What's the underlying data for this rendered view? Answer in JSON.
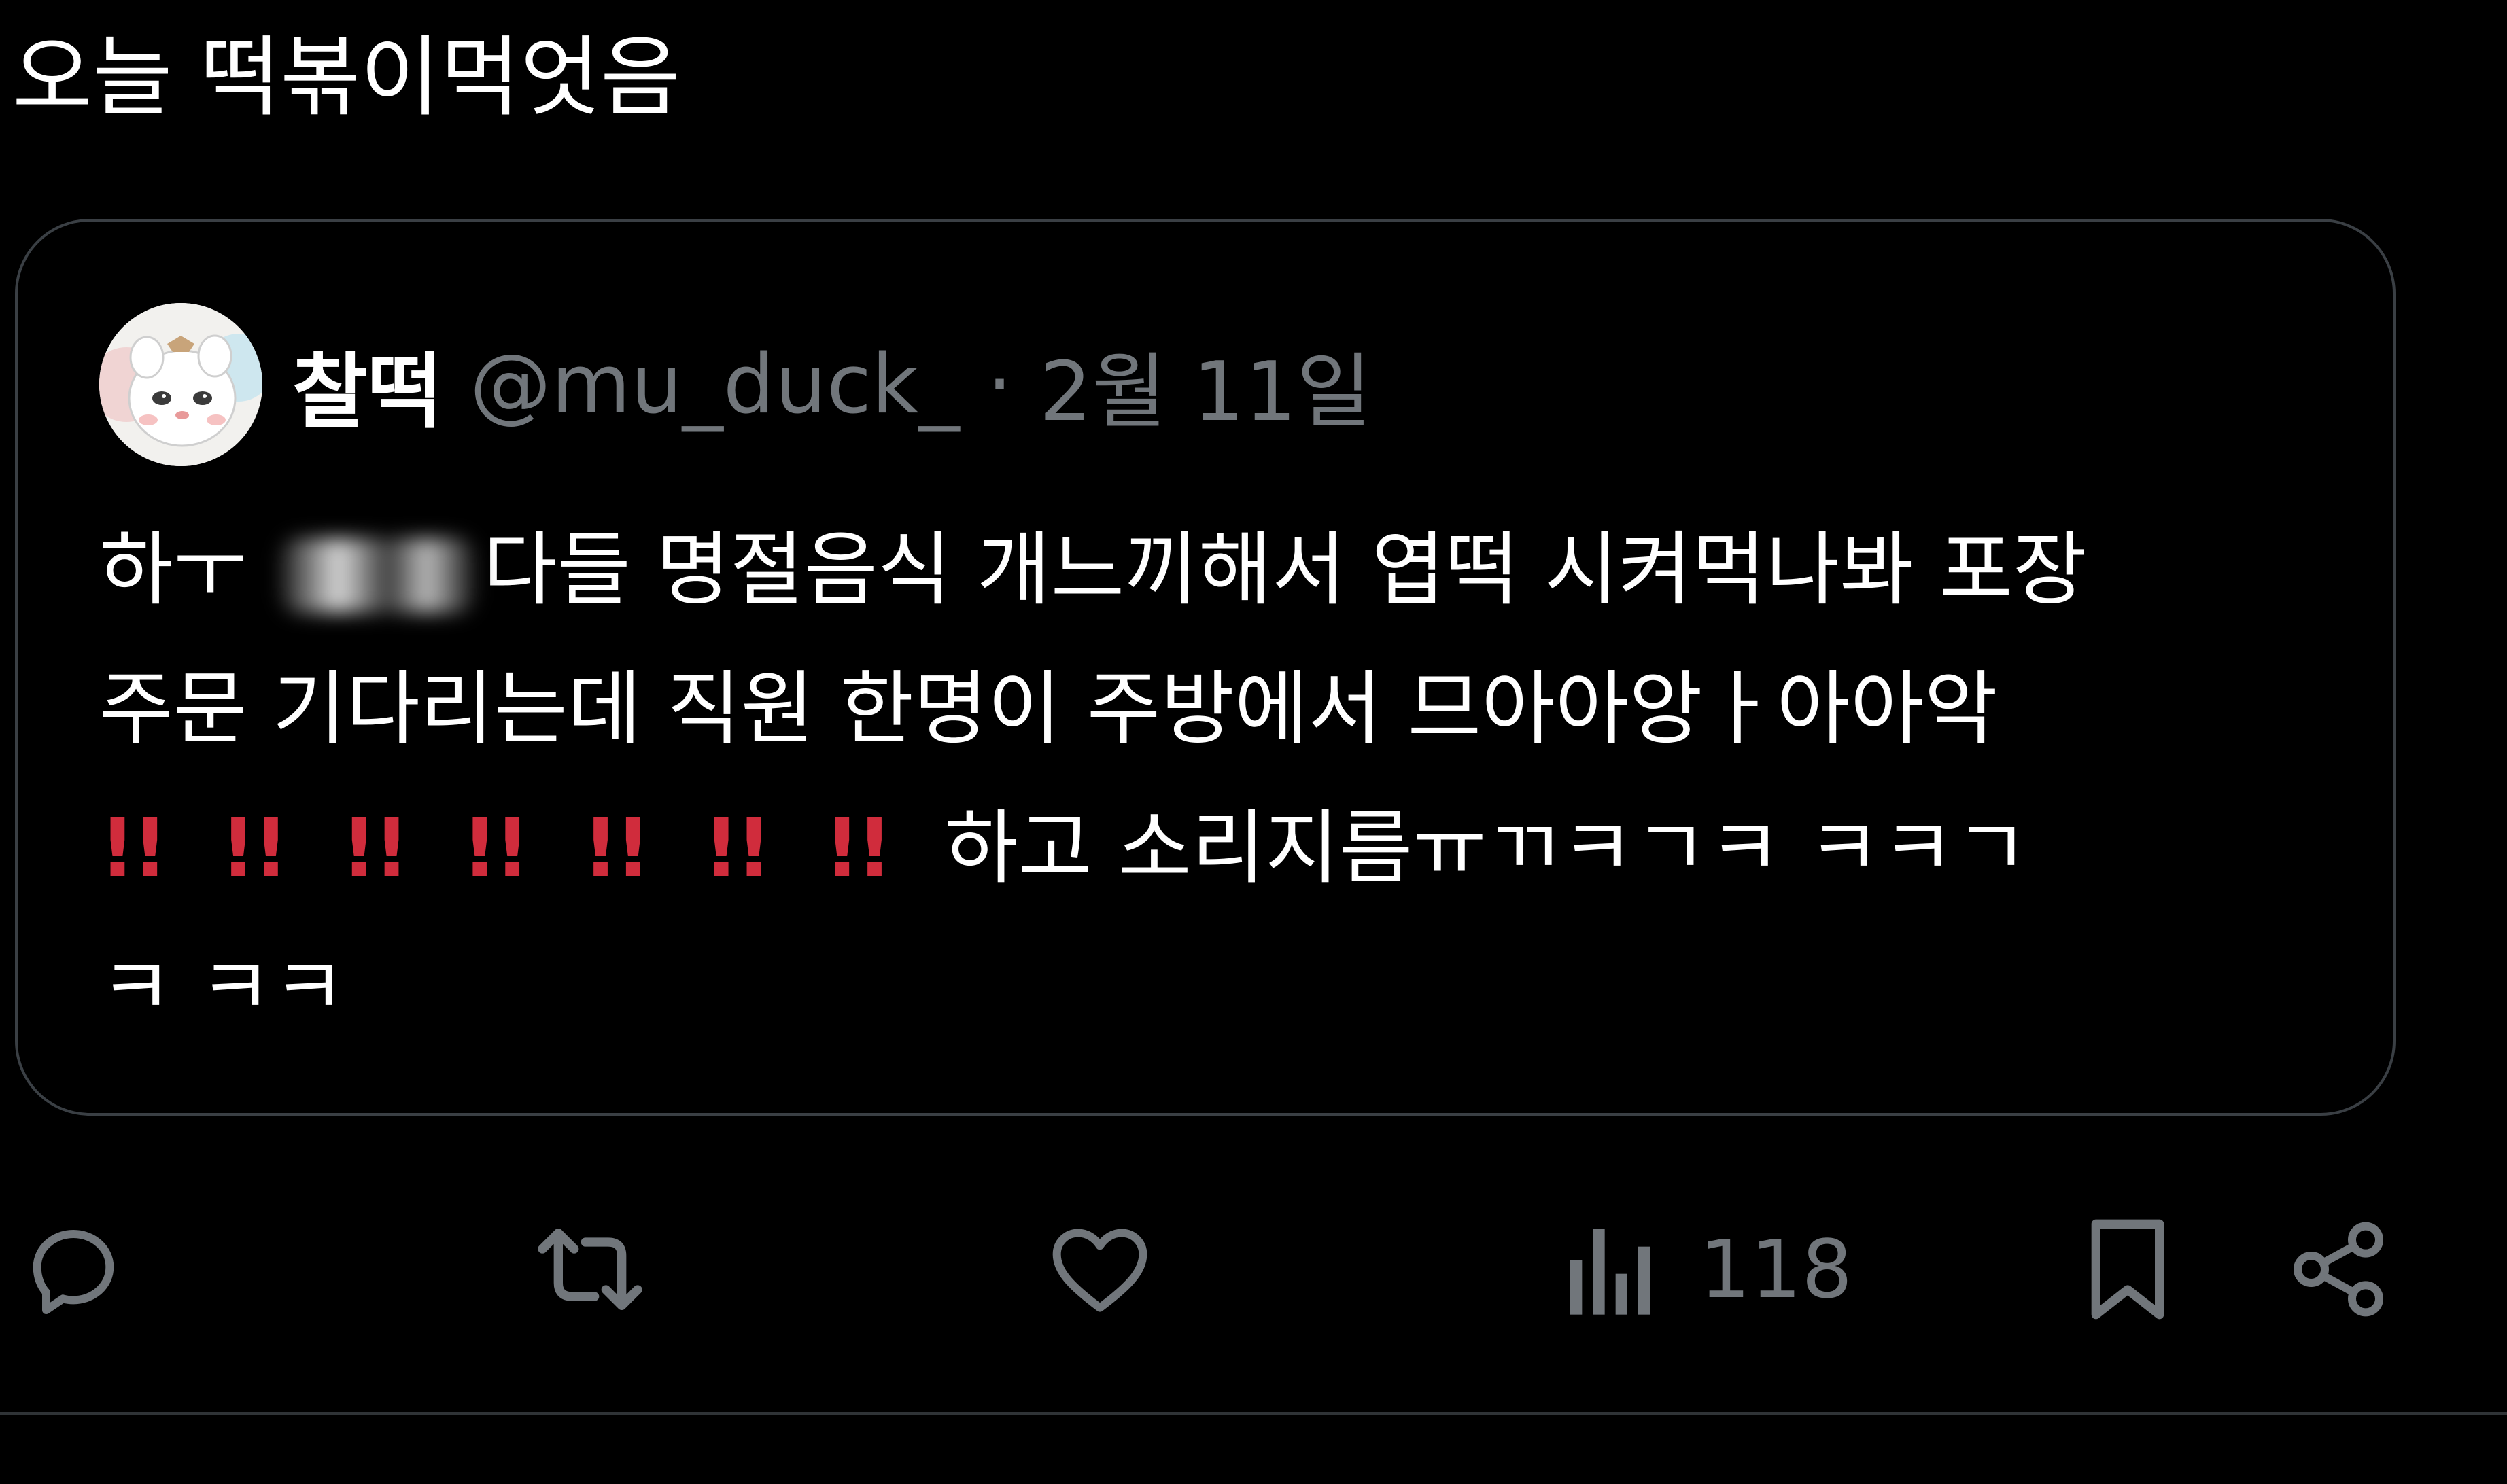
{
  "tweet": {
    "text": "오늘 떡볶이먹엇음"
  },
  "quote": {
    "display_name": "찰떡",
    "handle": "@mu_duck_",
    "separator": "·",
    "date": "2월 11일",
    "body": {
      "line1_pre": "하ㅜ ",
      "line1_post": "다들 명절음식 개느끼해서 엽떡 시켜먹나봐 포장",
      "line2": "주문 기다리는데 직원 한명이 주방에서 므아아앙ㅏ아아악",
      "exclaims": [
        "!!",
        "!!",
        "!!",
        "!!",
        "!!",
        "!!",
        "!!"
      ],
      "line3_post": "하고 소리지름ㅠㄲㅋㄱㅋ ㅋㅋㄱ",
      "line4": "ㅋ ㅋㅋ"
    }
  },
  "actions": {
    "views": "118"
  },
  "colors": {
    "background": "#000000",
    "text": "#ffffff",
    "muted": "#71767b",
    "border": "#3a3f44",
    "exclaim_red": "#d02c3c"
  },
  "icons": [
    "reply-icon",
    "retweet-icon",
    "like-icon",
    "views-icon",
    "bookmark-icon",
    "share-icon"
  ]
}
